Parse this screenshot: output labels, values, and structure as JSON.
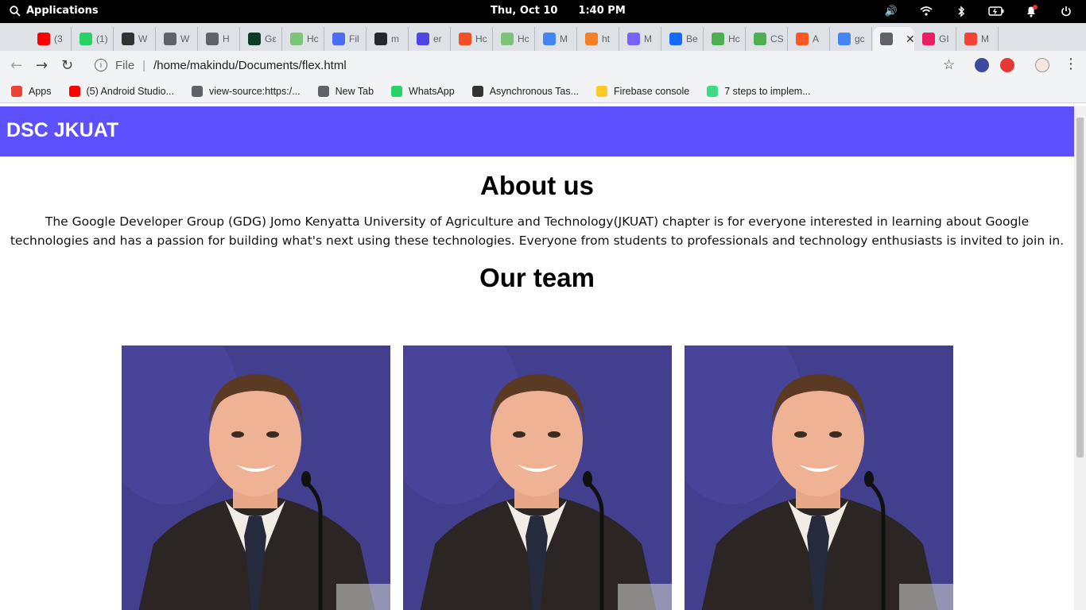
{
  "system": {
    "menu_label": "Applications",
    "date": "Thu, Oct 10",
    "time": "1:40 PM"
  },
  "tabs": [
    {
      "label": "(3",
      "icon": "youtube-icon",
      "color": "#ff0000"
    },
    {
      "label": "(1)",
      "icon": "whatsapp-icon",
      "color": "#25d366"
    },
    {
      "label": "W",
      "icon": "site-icon",
      "color": "#333333"
    },
    {
      "label": "W",
      "icon": "globe-icon",
      "color": "#5f6368"
    },
    {
      "label": "H",
      "icon": "globe-icon",
      "color": "#5f6368"
    },
    {
      "label": "Gε",
      "icon": "django-icon",
      "color": "#0c3c26"
    },
    {
      "label": "Hc",
      "icon": "site-icon",
      "color": "#7cc576"
    },
    {
      "label": "Fil",
      "icon": "flag-icon",
      "color": "#4a6cf7"
    },
    {
      "label": "m",
      "icon": "github-icon",
      "color": "#24292e"
    },
    {
      "label": "er",
      "icon": "shield-icon",
      "color": "#4f46e5"
    },
    {
      "label": "Hc",
      "icon": "windows-icon",
      "color": "#f25022"
    },
    {
      "label": "Hc",
      "icon": "site-icon",
      "color": "#7cc576"
    },
    {
      "label": "M",
      "icon": "site-icon",
      "color": "#4285f4"
    },
    {
      "label": "ht",
      "icon": "stack-icon",
      "color": "#f48024"
    },
    {
      "label": "M",
      "icon": "site-icon",
      "color": "#7b61ff"
    },
    {
      "label": "Be",
      "icon": "behance-icon",
      "color": "#1769ff"
    },
    {
      "label": "Hc",
      "icon": "w3-icon",
      "color": "#4caf50"
    },
    {
      "label": "CS",
      "icon": "w3-icon",
      "color": "#4caf50"
    },
    {
      "label": "A",
      "icon": "site-icon",
      "color": "#ff5722"
    },
    {
      "label": "gc",
      "icon": "google-icon",
      "color": "#4285f4"
    },
    {
      "label": "",
      "icon": "globe-icon",
      "color": "#5f6368",
      "active": true
    },
    {
      "label": "GI",
      "icon": "site-icon",
      "color": "#e91e63"
    },
    {
      "label": "M",
      "icon": "site-icon",
      "color": "#f44336"
    }
  ],
  "toolbar": {
    "scheme": "File",
    "url": "/home/makindu/Documents/flex.html"
  },
  "bookmarks": [
    {
      "label": "Apps",
      "icon": "apps-grid-icon",
      "color": "#ea4335"
    },
    {
      "label": "(5) Android Studio...",
      "icon": "youtube-icon",
      "color": "#ff0000"
    },
    {
      "label": "view-source:https:/...",
      "icon": "globe-icon",
      "color": "#5f6368"
    },
    {
      "label": "New Tab",
      "icon": "globe-icon",
      "color": "#5f6368"
    },
    {
      "label": "WhatsApp",
      "icon": "whatsapp-icon",
      "color": "#25d366"
    },
    {
      "label": "Asynchronous Tas...",
      "icon": "site-icon",
      "color": "#333333"
    },
    {
      "label": "Firebase console",
      "icon": "firebase-icon",
      "color": "#ffca28"
    },
    {
      "label": "7 steps to implem...",
      "icon": "android-icon",
      "color": "#3ddc84"
    }
  ],
  "page": {
    "brand": "DSC JKUAT",
    "brand_color": "#5d50fe",
    "about_title": "About us",
    "about_text": "The Google Developer Group (GDG) Jomo Kenyatta University of Agriculture and Technology(JKUAT) chapter is for everyone interested in learning about Google technologies and has a passion for building what's next using these technologies. Everyone from students to professionals and technology enthusiasts is invited to join in.",
    "team_title": "Our team",
    "team_members": [
      {
        "photo": "team-member-photo"
      },
      {
        "photo": "team-member-photo"
      },
      {
        "photo": "team-member-photo"
      }
    ]
  }
}
